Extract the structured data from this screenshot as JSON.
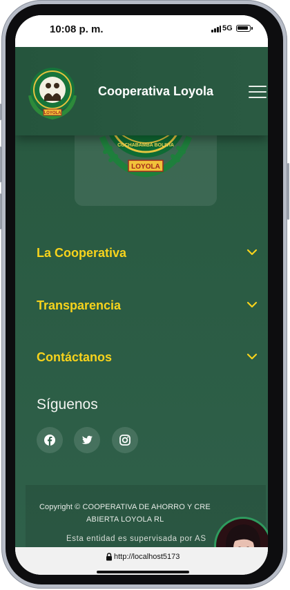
{
  "status_bar": {
    "time": "10:08 p. m.",
    "network": "5G"
  },
  "navbar": {
    "brand": "Cooperativa Loyola",
    "menu_icon": "hamburger-icon"
  },
  "logo": {
    "ring_text": "COOPERATIVA DE AHORRO Y CREDITO",
    "city": "COCHABAMBA BOLIVIA",
    "name": "LOYOLA"
  },
  "sections": [
    {
      "label": "La Cooperativa",
      "icon": "chevron-down-icon"
    },
    {
      "label": "Transparencia",
      "icon": "chevron-down-icon"
    },
    {
      "label": "Contáctanos",
      "icon": "chevron-down-icon"
    }
  ],
  "follow": {
    "title": "Síguenos",
    "networks": [
      {
        "icon": "facebook-icon"
      },
      {
        "icon": "twitter-icon"
      },
      {
        "icon": "instagram-icon"
      }
    ]
  },
  "footer": {
    "copyright_line1": "Copyright © COOPERATIVA DE AHORRO Y CRE",
    "copyright_line2": "ABIERTA LOYOLA RL",
    "supervision": "Esta entidad es supervisada por AS"
  },
  "browser": {
    "url": "http://localhost5173"
  },
  "colors": {
    "background": "#2b5c44",
    "accent_yellow": "#f7d31c",
    "text_light": "#f2f4f1"
  }
}
